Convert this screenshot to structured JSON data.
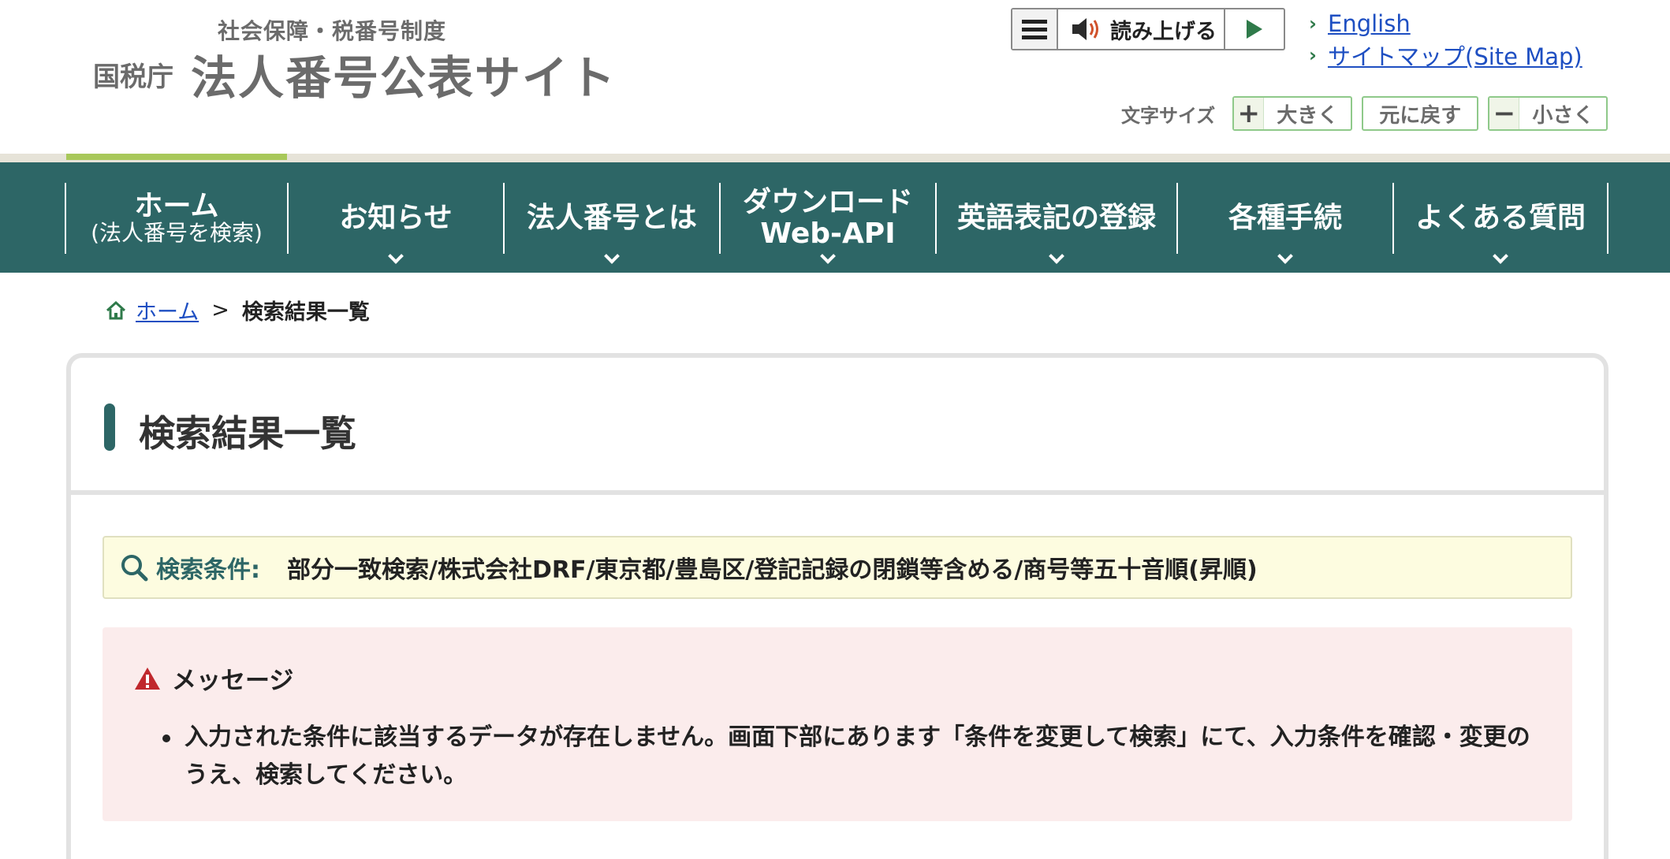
{
  "header": {
    "logo_subtitle": "社会保障・税番号制度",
    "logo_agency": "国税庁",
    "logo_title": "法人番号公表サイト",
    "reader": {
      "read_label": "読み上げる"
    },
    "links": [
      {
        "label": "English"
      },
      {
        "label": "サイトマップ(Site Map)"
      }
    ],
    "text_size": {
      "label": "文字サイズ",
      "larger_symbol": "+",
      "larger": "大きく",
      "reset": "元に戻す",
      "smaller_symbol": "−",
      "smaller": "小さく"
    }
  },
  "nav": {
    "items": [
      {
        "label": "ホーム",
        "sub": "(法人番号を検索)"
      },
      {
        "label": "お知らせ"
      },
      {
        "label": "法人番号とは"
      },
      {
        "label": "ダウンロード",
        "sub": "Web-API"
      },
      {
        "label": "英語表記の登録"
      },
      {
        "label": "各種手続"
      },
      {
        "label": "よくある質問"
      }
    ]
  },
  "breadcrumb": {
    "home": "ホーム",
    "separator": ">",
    "current": "検索結果一覧"
  },
  "main": {
    "title": "検索結果一覧",
    "criteria": {
      "label": "検索条件:",
      "value": "部分一致検索/株式会社DRF/東京都/豊島区/登記記録の閉鎖等含める/商号等五十音順(昇順)"
    },
    "message": {
      "heading": "メッセージ",
      "items": [
        "入力された条件に該当するデータが存在しません。画面下部にあります「条件を変更して検索」にて、入力条件を確認・変更のうえ、検索してください。"
      ]
    }
  },
  "colors": {
    "nav_bg": "#2d6666",
    "accent_green": "#a8c85a",
    "link_blue": "#1e4fc2",
    "criteria_bg": "#fdfce0",
    "message_bg": "#fbecec",
    "warning_red": "#c0282d"
  }
}
